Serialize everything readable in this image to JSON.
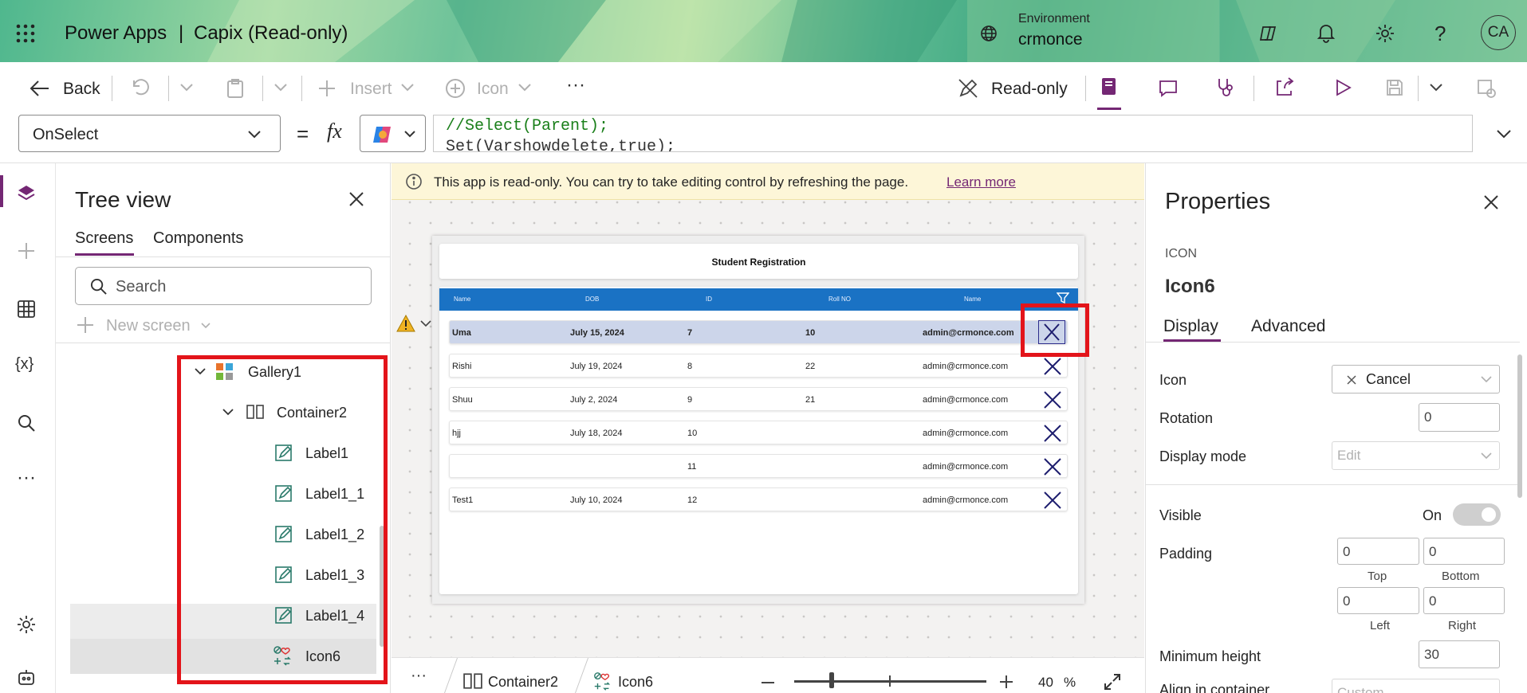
{
  "header": {
    "app_name": "Power Apps",
    "separator": "|",
    "app_title": "Capix (Read-only)",
    "environment_label": "Environment",
    "environment_name": "crmonce",
    "avatar_initials": "CA"
  },
  "toolbar": {
    "back_label": "Back",
    "insert_label": "Insert",
    "icon_label": "Icon",
    "more_label": "···",
    "readonly_label": "Read-only"
  },
  "formula": {
    "property": "OnSelect",
    "equals": "=",
    "fx": "fx",
    "line1": "//Select(Parent);",
    "line2": "Set(Varshowdelete,true);"
  },
  "tree": {
    "title": "Tree view",
    "tabs": [
      "Screens",
      "Components"
    ],
    "search_placeholder": "Search",
    "new_screen": "New screen",
    "items": [
      "Gallery1",
      "Container2",
      "Label1",
      "Label1_1",
      "Label1_2",
      "Label1_3",
      "Label1_4",
      "Icon6"
    ]
  },
  "banner": {
    "message": "This app is read-only. You can try to take editing control by refreshing the page.",
    "link": "Learn more"
  },
  "app_screen": {
    "title": "Student Registration",
    "columns": [
      "Name",
      "DOB",
      "ID",
      "Roll NO",
      "Name"
    ],
    "rows": [
      {
        "name": "Uma",
        "dob": "July 15, 2024",
        "id": "7",
        "roll": "10",
        "email": "admin@crmonce.com"
      },
      {
        "name": "Rishi",
        "dob": "July 19, 2024",
        "id": "8",
        "roll": "22",
        "email": "admin@crmonce.com"
      },
      {
        "name": "Shuu",
        "dob": "July 2, 2024",
        "id": "9",
        "roll": "21",
        "email": "admin@crmonce.com"
      },
      {
        "name": "hjj",
        "dob": "July 18, 2024",
        "id": "10",
        "roll": "",
        "email": "admin@crmonce.com"
      },
      {
        "name": "",
        "dob": "",
        "id": "11",
        "roll": "",
        "email": "admin@crmonce.com"
      },
      {
        "name": "Test1",
        "dob": "July 10, 2024",
        "id": "12",
        "roll": "",
        "email": "admin@crmonce.com"
      }
    ]
  },
  "status": {
    "more": "···",
    "crumb1": "Container2",
    "crumb2": "Icon6",
    "zoom_value": "40",
    "zoom_unit": "%"
  },
  "properties": {
    "title": "Properties",
    "type": "ICON",
    "name": "Icon6",
    "tabs": [
      "Display",
      "Advanced"
    ],
    "icon_label": "Icon",
    "icon_value": "Cancel",
    "rotation_label": "Rotation",
    "rotation_value": "0",
    "display_mode_label": "Display mode",
    "display_mode_value": "Edit",
    "visible_label": "Visible",
    "visible_value": "On",
    "padding_label": "Padding",
    "padding_top": "0",
    "padding_bottom": "0",
    "padding_left": "0",
    "padding_right": "0",
    "top_label": "Top",
    "bottom_label": "Bottom",
    "left_label": "Left",
    "right_label": "Right",
    "min_height_label": "Minimum height",
    "min_height_value": "30",
    "align_label": "Align in container",
    "align_value": "Custom"
  },
  "colors": {
    "accent": "#742774",
    "gallery_header": "#1a72c4",
    "highlight": "#e3141a",
    "banner": "#fdf6d8"
  }
}
